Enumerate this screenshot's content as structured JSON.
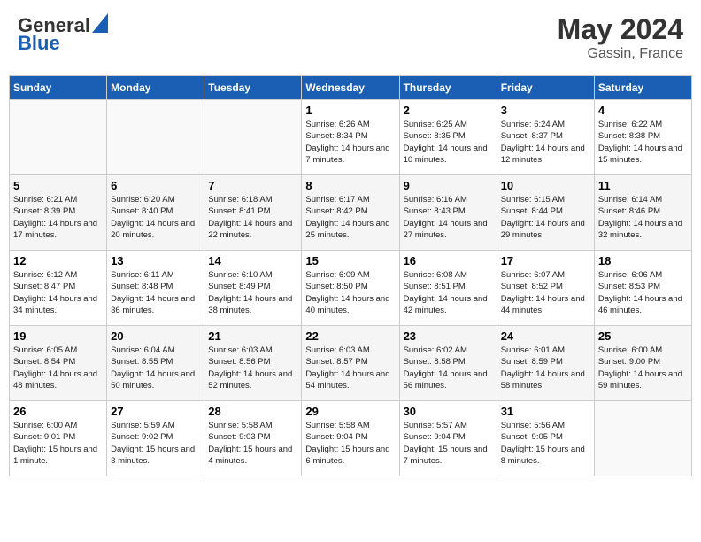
{
  "header": {
    "logo_general": "General",
    "logo_blue": "Blue",
    "title": "May 2024",
    "location": "Gassin, France"
  },
  "calendar": {
    "days_of_week": [
      "Sunday",
      "Monday",
      "Tuesday",
      "Wednesday",
      "Thursday",
      "Friday",
      "Saturday"
    ],
    "weeks": [
      [
        {
          "day": "",
          "sunrise": "",
          "sunset": "",
          "daylight": ""
        },
        {
          "day": "",
          "sunrise": "",
          "sunset": "",
          "daylight": ""
        },
        {
          "day": "",
          "sunrise": "",
          "sunset": "",
          "daylight": ""
        },
        {
          "day": "1",
          "sunrise": "Sunrise: 6:26 AM",
          "sunset": "Sunset: 8:34 PM",
          "daylight": "Daylight: 14 hours and 7 minutes."
        },
        {
          "day": "2",
          "sunrise": "Sunrise: 6:25 AM",
          "sunset": "Sunset: 8:35 PM",
          "daylight": "Daylight: 14 hours and 10 minutes."
        },
        {
          "day": "3",
          "sunrise": "Sunrise: 6:24 AM",
          "sunset": "Sunset: 8:37 PM",
          "daylight": "Daylight: 14 hours and 12 minutes."
        },
        {
          "day": "4",
          "sunrise": "Sunrise: 6:22 AM",
          "sunset": "Sunset: 8:38 PM",
          "daylight": "Daylight: 14 hours and 15 minutes."
        }
      ],
      [
        {
          "day": "5",
          "sunrise": "Sunrise: 6:21 AM",
          "sunset": "Sunset: 8:39 PM",
          "daylight": "Daylight: 14 hours and 17 minutes."
        },
        {
          "day": "6",
          "sunrise": "Sunrise: 6:20 AM",
          "sunset": "Sunset: 8:40 PM",
          "daylight": "Daylight: 14 hours and 20 minutes."
        },
        {
          "day": "7",
          "sunrise": "Sunrise: 6:18 AM",
          "sunset": "Sunset: 8:41 PM",
          "daylight": "Daylight: 14 hours and 22 minutes."
        },
        {
          "day": "8",
          "sunrise": "Sunrise: 6:17 AM",
          "sunset": "Sunset: 8:42 PM",
          "daylight": "Daylight: 14 hours and 25 minutes."
        },
        {
          "day": "9",
          "sunrise": "Sunrise: 6:16 AM",
          "sunset": "Sunset: 8:43 PM",
          "daylight": "Daylight: 14 hours and 27 minutes."
        },
        {
          "day": "10",
          "sunrise": "Sunrise: 6:15 AM",
          "sunset": "Sunset: 8:44 PM",
          "daylight": "Daylight: 14 hours and 29 minutes."
        },
        {
          "day": "11",
          "sunrise": "Sunrise: 6:14 AM",
          "sunset": "Sunset: 8:46 PM",
          "daylight": "Daylight: 14 hours and 32 minutes."
        }
      ],
      [
        {
          "day": "12",
          "sunrise": "Sunrise: 6:12 AM",
          "sunset": "Sunset: 8:47 PM",
          "daylight": "Daylight: 14 hours and 34 minutes."
        },
        {
          "day": "13",
          "sunrise": "Sunrise: 6:11 AM",
          "sunset": "Sunset: 8:48 PM",
          "daylight": "Daylight: 14 hours and 36 minutes."
        },
        {
          "day": "14",
          "sunrise": "Sunrise: 6:10 AM",
          "sunset": "Sunset: 8:49 PM",
          "daylight": "Daylight: 14 hours and 38 minutes."
        },
        {
          "day": "15",
          "sunrise": "Sunrise: 6:09 AM",
          "sunset": "Sunset: 8:50 PM",
          "daylight": "Daylight: 14 hours and 40 minutes."
        },
        {
          "day": "16",
          "sunrise": "Sunrise: 6:08 AM",
          "sunset": "Sunset: 8:51 PM",
          "daylight": "Daylight: 14 hours and 42 minutes."
        },
        {
          "day": "17",
          "sunrise": "Sunrise: 6:07 AM",
          "sunset": "Sunset: 8:52 PM",
          "daylight": "Daylight: 14 hours and 44 minutes."
        },
        {
          "day": "18",
          "sunrise": "Sunrise: 6:06 AM",
          "sunset": "Sunset: 8:53 PM",
          "daylight": "Daylight: 14 hours and 46 minutes."
        }
      ],
      [
        {
          "day": "19",
          "sunrise": "Sunrise: 6:05 AM",
          "sunset": "Sunset: 8:54 PM",
          "daylight": "Daylight: 14 hours and 48 minutes."
        },
        {
          "day": "20",
          "sunrise": "Sunrise: 6:04 AM",
          "sunset": "Sunset: 8:55 PM",
          "daylight": "Daylight: 14 hours and 50 minutes."
        },
        {
          "day": "21",
          "sunrise": "Sunrise: 6:03 AM",
          "sunset": "Sunset: 8:56 PM",
          "daylight": "Daylight: 14 hours and 52 minutes."
        },
        {
          "day": "22",
          "sunrise": "Sunrise: 6:03 AM",
          "sunset": "Sunset: 8:57 PM",
          "daylight": "Daylight: 14 hours and 54 minutes."
        },
        {
          "day": "23",
          "sunrise": "Sunrise: 6:02 AM",
          "sunset": "Sunset: 8:58 PM",
          "daylight": "Daylight: 14 hours and 56 minutes."
        },
        {
          "day": "24",
          "sunrise": "Sunrise: 6:01 AM",
          "sunset": "Sunset: 8:59 PM",
          "daylight": "Daylight: 14 hours and 58 minutes."
        },
        {
          "day": "25",
          "sunrise": "Sunrise: 6:00 AM",
          "sunset": "Sunset: 9:00 PM",
          "daylight": "Daylight: 14 hours and 59 minutes."
        }
      ],
      [
        {
          "day": "26",
          "sunrise": "Sunrise: 6:00 AM",
          "sunset": "Sunset: 9:01 PM",
          "daylight": "Daylight: 15 hours and 1 minute."
        },
        {
          "day": "27",
          "sunrise": "Sunrise: 5:59 AM",
          "sunset": "Sunset: 9:02 PM",
          "daylight": "Daylight: 15 hours and 3 minutes."
        },
        {
          "day": "28",
          "sunrise": "Sunrise: 5:58 AM",
          "sunset": "Sunset: 9:03 PM",
          "daylight": "Daylight: 15 hours and 4 minutes."
        },
        {
          "day": "29",
          "sunrise": "Sunrise: 5:58 AM",
          "sunset": "Sunset: 9:04 PM",
          "daylight": "Daylight: 15 hours and 6 minutes."
        },
        {
          "day": "30",
          "sunrise": "Sunrise: 5:57 AM",
          "sunset": "Sunset: 9:04 PM",
          "daylight": "Daylight: 15 hours and 7 minutes."
        },
        {
          "day": "31",
          "sunrise": "Sunrise: 5:56 AM",
          "sunset": "Sunset: 9:05 PM",
          "daylight": "Daylight: 15 hours and 8 minutes."
        },
        {
          "day": "",
          "sunrise": "",
          "sunset": "",
          "daylight": ""
        }
      ]
    ]
  }
}
